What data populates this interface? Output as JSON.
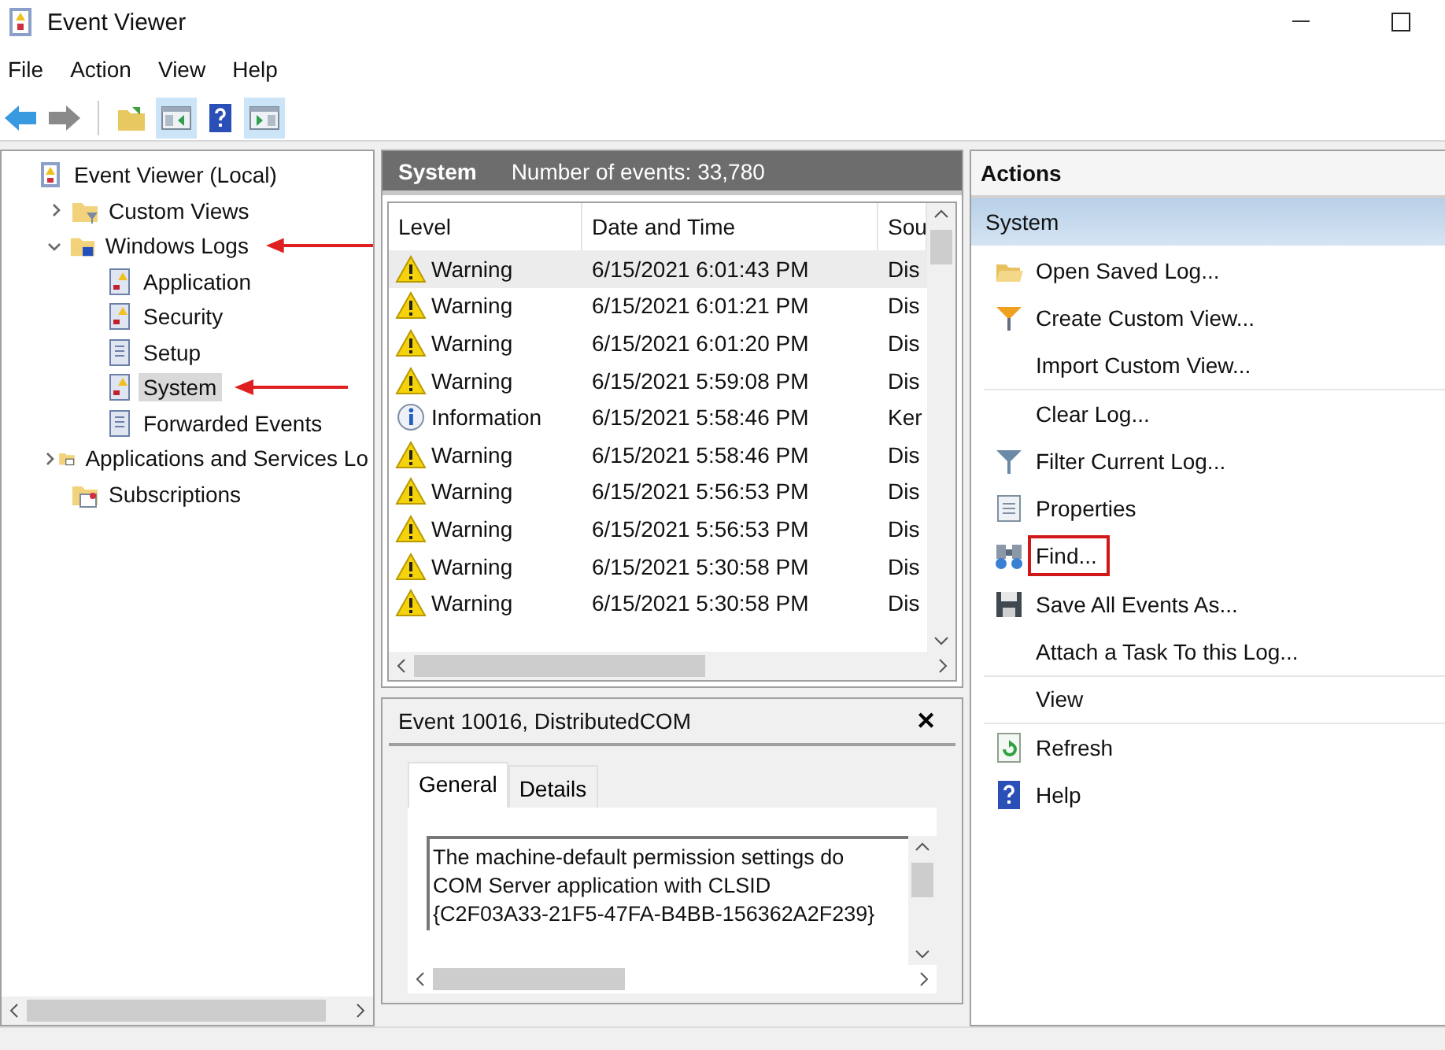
{
  "window": {
    "title": "Event Viewer"
  },
  "menu": [
    "File",
    "Action",
    "View",
    "Help"
  ],
  "toolbar": [
    {
      "kind": "back",
      "selected": false
    },
    {
      "kind": "forward",
      "selected": false
    },
    {
      "kind": "up",
      "selected": false
    },
    {
      "kind": "tree",
      "selected": true
    },
    {
      "kind": "help",
      "selected": false
    },
    {
      "kind": "actions",
      "selected": true
    }
  ],
  "tree": [
    {
      "label": "Event Viewer (Local)",
      "kind": "viewer",
      "selected": false,
      "children": [
        {
          "label": "Custom Views",
          "kind": "filter-folder",
          "expanded": false,
          "selected": false
        },
        {
          "label": "Windows Logs",
          "kind": "windows-folder",
          "expanded": true,
          "selected": false,
          "marked": true,
          "children": [
            {
              "label": "Application",
              "kind": "alert-log",
              "selected": false
            },
            {
              "label": "Security",
              "kind": "alert-log",
              "selected": false
            },
            {
              "label": "Setup",
              "kind": "plain-log",
              "selected": false
            },
            {
              "label": "System",
              "kind": "alert-log",
              "selected": true,
              "marked": true
            },
            {
              "label": "Forwarded Events",
              "kind": "plain-log",
              "selected": false
            }
          ]
        },
        {
          "label": "Applications and Services Lo",
          "kind": "folder",
          "expanded": false,
          "selected": false
        },
        {
          "label": "Subscriptions",
          "kind": "subscriptions",
          "selected": false
        }
      ]
    }
  ],
  "log_header": {
    "name": "System",
    "count": "Number of events: 33,780"
  },
  "table": {
    "columns": [
      "Level",
      "Date and Time",
      "Sou"
    ],
    "rows": [
      {
        "kind": "warning",
        "level": "Warning",
        "date": "6/15/2021 6:01:43 PM",
        "source": "Dis",
        "selected": true
      },
      {
        "kind": "warning",
        "level": "Warning",
        "date": "6/15/2021 6:01:21 PM",
        "source": "Dis",
        "selected": false
      },
      {
        "kind": "warning",
        "level": "Warning",
        "date": "6/15/2021 6:01:20 PM",
        "source": "Dis",
        "selected": false
      },
      {
        "kind": "warning",
        "level": "Warning",
        "date": "6/15/2021 5:59:08 PM",
        "source": "Dis",
        "selected": false
      },
      {
        "kind": "information",
        "level": "Information",
        "date": "6/15/2021 5:58:46 PM",
        "source": "Ker",
        "selected": false
      },
      {
        "kind": "warning",
        "level": "Warning",
        "date": "6/15/2021 5:58:46 PM",
        "source": "Dis",
        "selected": false
      },
      {
        "kind": "warning",
        "level": "Warning",
        "date": "6/15/2021 5:56:53 PM",
        "source": "Dis",
        "selected": false
      },
      {
        "kind": "warning",
        "level": "Warning",
        "date": "6/15/2021 5:56:53 PM",
        "source": "Dis",
        "selected": false
      },
      {
        "kind": "warning",
        "level": "Warning",
        "date": "6/15/2021 5:30:58 PM",
        "source": "Dis",
        "selected": false
      },
      {
        "kind": "warning",
        "level": "Warning",
        "date": "6/15/2021 5:30:58 PM",
        "source": "Dis",
        "selected": false
      }
    ]
  },
  "detail": {
    "title": "Event 10016, DistributedCOM",
    "close": "✕",
    "tabs": [
      {
        "label": "General",
        "selected": true
      },
      {
        "label": "Details",
        "selected": false
      }
    ],
    "lines": [
      "The machine-default permission settings do",
      "COM Server application with CLSID",
      "{C2F03A33-21F5-47FA-B4BB-156362A2F239}"
    ]
  },
  "actions": {
    "title": "Actions",
    "section": "System",
    "items": [
      {
        "label": "Open Saved Log...",
        "kind": "open",
        "separated": false,
        "highlighted": false
      },
      {
        "label": "Create Custom View...",
        "kind": "create-filter",
        "separated": false,
        "highlighted": false
      },
      {
        "label": "Import Custom View...",
        "kind": "none",
        "separated": false,
        "highlighted": false
      },
      {
        "label": "Clear Log...",
        "kind": "none",
        "separated": true,
        "highlighted": false
      },
      {
        "label": "Filter Current Log...",
        "kind": "filter",
        "separated": false,
        "highlighted": false
      },
      {
        "label": "Properties",
        "kind": "properties",
        "separated": false,
        "highlighted": false
      },
      {
        "label": "Find...",
        "kind": "find",
        "separated": false,
        "highlighted": true
      },
      {
        "label": "Save All Events As...",
        "kind": "save",
        "separated": false,
        "highlighted": false
      },
      {
        "label": "Attach a Task To this Log...",
        "kind": "none",
        "separated": false,
        "highlighted": false
      },
      {
        "label": "View",
        "kind": "none",
        "separated": true,
        "highlighted": false
      },
      {
        "label": "Refresh",
        "kind": "refresh",
        "separated": true,
        "highlighted": false
      },
      {
        "label": "Help",
        "kind": "help",
        "separated": false,
        "highlighted": false
      }
    ]
  }
}
